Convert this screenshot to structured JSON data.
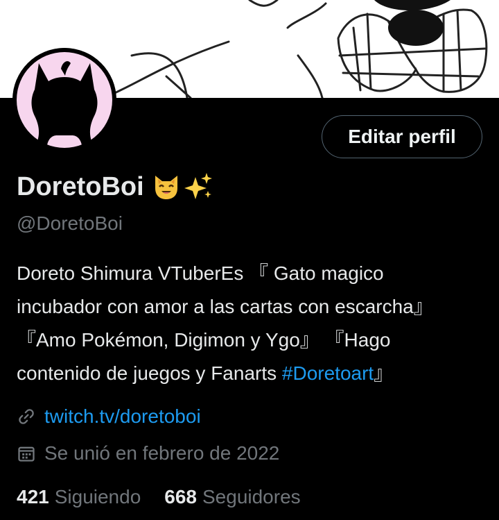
{
  "profile": {
    "display_name": "DoretoBoi",
    "name_emoji": [
      "cat-face-emoji",
      "sparkles-emoji"
    ],
    "handle": "@DoretoBoi",
    "edit_button": "Editar perfil",
    "bio": {
      "text": "Doreto Shimura VTuberEs 『 Gato magico incubador con amor a las cartas con escarcha』 『Amo Pokémon, Digimon y Ygo』 『Hago contenido de juegos y Fanarts ",
      "hashtag": "#Doretoart",
      "tail": "』"
    },
    "website": {
      "icon": "link-icon",
      "text": "twitch.tv/doretoboi"
    },
    "joined": {
      "icon": "calendar-icon",
      "text": "Se unió en febrero de 2022"
    },
    "stats": {
      "following_count": "421",
      "following_label": "Siguiendo",
      "followers_count": "668",
      "followers_label": "Seguidores"
    }
  },
  "colors": {
    "background": "#000000",
    "text": "#e7e9ea",
    "muted": "#71767b",
    "link": "#1d9bf0",
    "button_border": "#536471",
    "avatar_bg": "#f7d6ee"
  }
}
